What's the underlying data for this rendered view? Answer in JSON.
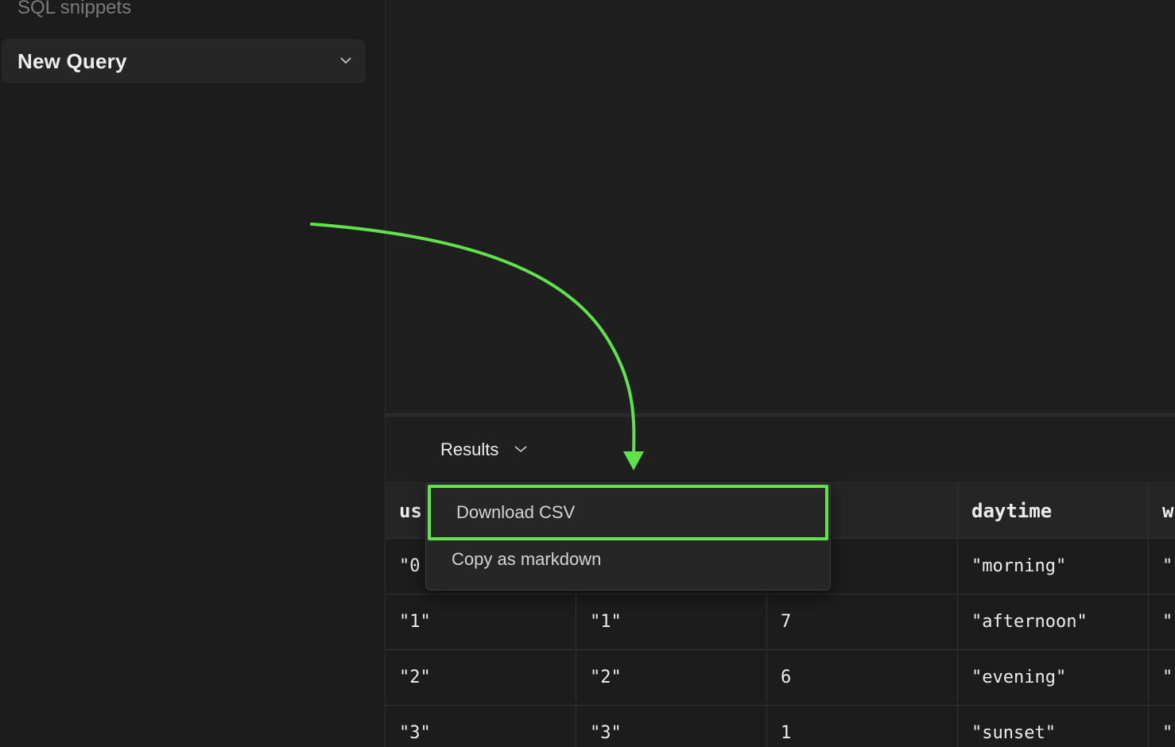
{
  "sidebar": {
    "section_title": "SQL snippets",
    "snippet": {
      "label": "New Query"
    }
  },
  "results": {
    "tab_label": "Results"
  },
  "menu": {
    "items": [
      {
        "label": "Download CSV"
      },
      {
        "label": "Copy as markdown"
      }
    ]
  },
  "table": {
    "headers": [
      "us",
      "",
      "",
      "daytime",
      "w"
    ],
    "rows": [
      [
        "\"0",
        "",
        "",
        "\"morning\"",
        "\""
      ],
      [
        "\"1\"",
        "\"1\"",
        "7",
        "\"afternoon\"",
        "\""
      ],
      [
        "\"2\"",
        "\"2\"",
        "6",
        "\"evening\"",
        "\""
      ],
      [
        "\"3\"",
        "\"3\"",
        "1",
        "\"sunset\"",
        "\""
      ]
    ]
  },
  "colors": {
    "accent": "#5fe24a",
    "background": "#1f1f1f",
    "sidebar": "#1c1c1c"
  },
  "icons": {
    "snippet_chevron": "chevron-down-icon",
    "results_chevron": "chevron-down-icon",
    "annotation": "arrow-annotation-icon"
  }
}
